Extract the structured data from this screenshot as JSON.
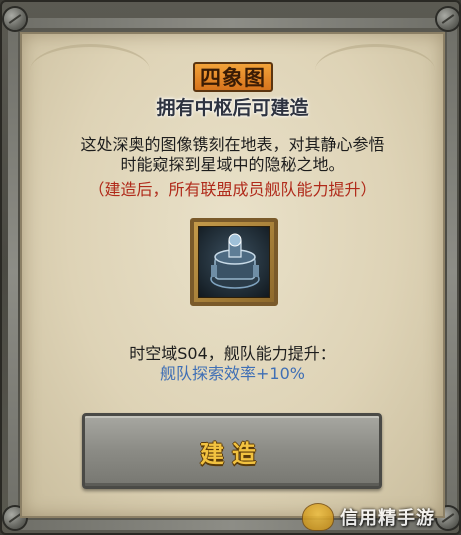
{
  "panel": {
    "title": "四象图",
    "subtitle": "拥有中枢后可建造",
    "description_line1": "这处深奥的图像镌刻在地表，对其静心参悟",
    "description_line2": "时能窥探到星域中的隐秘之地。",
    "note": "（建造后，所有联盟成员舰队能力提升）",
    "building_icon": "four-symbols-structure-icon",
    "effect_label": "时空域S04，舰队能力提升：",
    "effect_value": "舰队探索效率+10%",
    "build_button_label": "建造"
  },
  "watermark": {
    "text": "信用精手游",
    "logo_icon": "pot-logo-icon"
  },
  "colors": {
    "title_plate": "#e88a28",
    "note_red": "#b02a1a",
    "effect_blue": "#3f6fb5",
    "button_text_gold": "#f2c240"
  }
}
